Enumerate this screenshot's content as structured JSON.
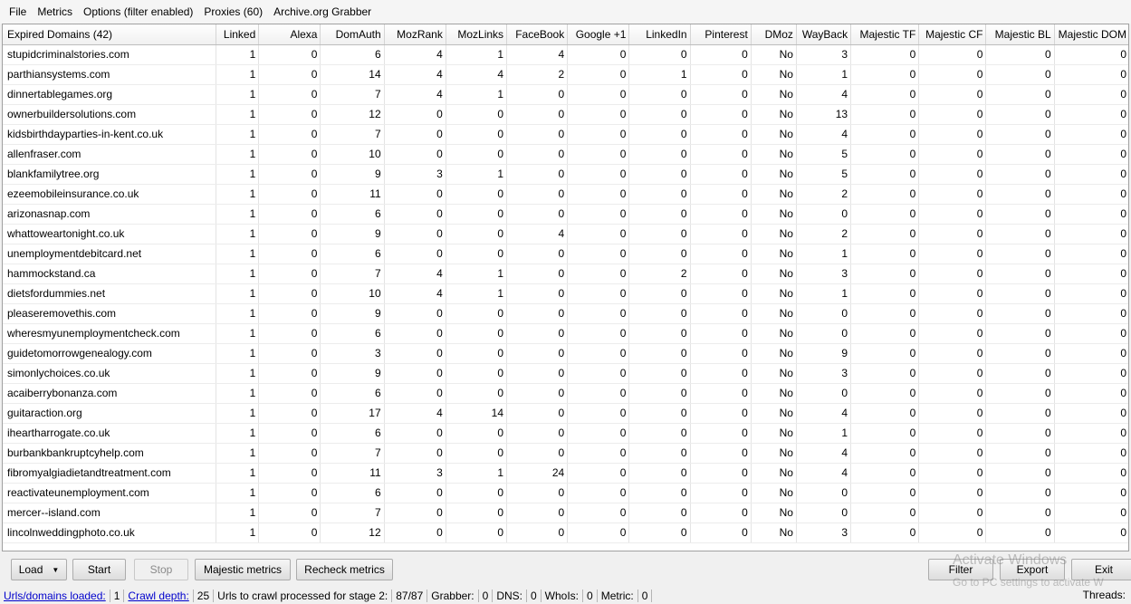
{
  "menu": [
    "File",
    "Metrics",
    "Options (filter enabled)",
    "Proxies (60)",
    "Archive.org Grabber"
  ],
  "table": {
    "columns": [
      "Expired Domains (42)",
      "Linked",
      "Alexa",
      "DomAuth",
      "MozRank",
      "MozLinks",
      "FaceBook",
      "Google +1",
      "LinkedIn",
      "Pinterest",
      "DMoz",
      "WayBack",
      "Majestic TF",
      "Majestic CF",
      "Majestic BL",
      "Majestic DOM"
    ],
    "rows": [
      [
        "stupidcriminalstories.com",
        "1",
        "0",
        "6",
        "4",
        "1",
        "4",
        "0",
        "0",
        "0",
        "No",
        "3",
        "0",
        "0",
        "0",
        "0"
      ],
      [
        "parthiansystems.com",
        "1",
        "0",
        "14",
        "4",
        "4",
        "2",
        "0",
        "1",
        "0",
        "No",
        "1",
        "0",
        "0",
        "0",
        "0"
      ],
      [
        "dinnertablegames.org",
        "1",
        "0",
        "7",
        "4",
        "1",
        "0",
        "0",
        "0",
        "0",
        "No",
        "4",
        "0",
        "0",
        "0",
        "0"
      ],
      [
        "ownerbuildersolutions.com",
        "1",
        "0",
        "12",
        "0",
        "0",
        "0",
        "0",
        "0",
        "0",
        "No",
        "13",
        "0",
        "0",
        "0",
        "0"
      ],
      [
        "kidsbirthdayparties-in-kent.co.uk",
        "1",
        "0",
        "7",
        "0",
        "0",
        "0",
        "0",
        "0",
        "0",
        "No",
        "4",
        "0",
        "0",
        "0",
        "0"
      ],
      [
        "allenfraser.com",
        "1",
        "0",
        "10",
        "0",
        "0",
        "0",
        "0",
        "0",
        "0",
        "No",
        "5",
        "0",
        "0",
        "0",
        "0"
      ],
      [
        "blankfamilytree.org",
        "1",
        "0",
        "9",
        "3",
        "1",
        "0",
        "0",
        "0",
        "0",
        "No",
        "5",
        "0",
        "0",
        "0",
        "0"
      ],
      [
        "ezeemobileinsurance.co.uk",
        "1",
        "0",
        "11",
        "0",
        "0",
        "0",
        "0",
        "0",
        "0",
        "No",
        "2",
        "0",
        "0",
        "0",
        "0"
      ],
      [
        "arizonasnap.com",
        "1",
        "0",
        "6",
        "0",
        "0",
        "0",
        "0",
        "0",
        "0",
        "No",
        "0",
        "0",
        "0",
        "0",
        "0"
      ],
      [
        "whattoweartonight.co.uk",
        "1",
        "0",
        "9",
        "0",
        "0",
        "4",
        "0",
        "0",
        "0",
        "No",
        "2",
        "0",
        "0",
        "0",
        "0"
      ],
      [
        "unemploymentdebitcard.net",
        "1",
        "0",
        "6",
        "0",
        "0",
        "0",
        "0",
        "0",
        "0",
        "No",
        "1",
        "0",
        "0",
        "0",
        "0"
      ],
      [
        "hammockstand.ca",
        "1",
        "0",
        "7",
        "4",
        "1",
        "0",
        "0",
        "2",
        "0",
        "No",
        "3",
        "0",
        "0",
        "0",
        "0"
      ],
      [
        "dietsfordummies.net",
        "1",
        "0",
        "10",
        "4",
        "1",
        "0",
        "0",
        "0",
        "0",
        "No",
        "1",
        "0",
        "0",
        "0",
        "0"
      ],
      [
        "pleaseremovethis.com",
        "1",
        "0",
        "9",
        "0",
        "0",
        "0",
        "0",
        "0",
        "0",
        "No",
        "0",
        "0",
        "0",
        "0",
        "0"
      ],
      [
        "wheresmyunemploymentcheck.com",
        "1",
        "0",
        "6",
        "0",
        "0",
        "0",
        "0",
        "0",
        "0",
        "No",
        "0",
        "0",
        "0",
        "0",
        "0"
      ],
      [
        "guidetomorrowgenealogy.com",
        "1",
        "0",
        "3",
        "0",
        "0",
        "0",
        "0",
        "0",
        "0",
        "No",
        "9",
        "0",
        "0",
        "0",
        "0"
      ],
      [
        "simonlychoices.co.uk",
        "1",
        "0",
        "9",
        "0",
        "0",
        "0",
        "0",
        "0",
        "0",
        "No",
        "3",
        "0",
        "0",
        "0",
        "0"
      ],
      [
        "acaiberrybonanza.com",
        "1",
        "0",
        "6",
        "0",
        "0",
        "0",
        "0",
        "0",
        "0",
        "No",
        "0",
        "0",
        "0",
        "0",
        "0"
      ],
      [
        "guitaraction.org",
        "1",
        "0",
        "17",
        "4",
        "14",
        "0",
        "0",
        "0",
        "0",
        "No",
        "4",
        "0",
        "0",
        "0",
        "0"
      ],
      [
        "iheartharrogate.co.uk",
        "1",
        "0",
        "6",
        "0",
        "0",
        "0",
        "0",
        "0",
        "0",
        "No",
        "1",
        "0",
        "0",
        "0",
        "0"
      ],
      [
        "burbankbankruptcyhelp.com",
        "1",
        "0",
        "7",
        "0",
        "0",
        "0",
        "0",
        "0",
        "0",
        "No",
        "4",
        "0",
        "0",
        "0",
        "0"
      ],
      [
        "fibromyalgiadietandtreatment.com",
        "1",
        "0",
        "11",
        "3",
        "1",
        "24",
        "0",
        "0",
        "0",
        "No",
        "4",
        "0",
        "0",
        "0",
        "0"
      ],
      [
        "reactivateunemployment.com",
        "1",
        "0",
        "6",
        "0",
        "0",
        "0",
        "0",
        "0",
        "0",
        "No",
        "0",
        "0",
        "0",
        "0",
        "0"
      ],
      [
        "mercer--island.com",
        "1",
        "0",
        "7",
        "0",
        "0",
        "0",
        "0",
        "0",
        "0",
        "No",
        "0",
        "0",
        "0",
        "0",
        "0"
      ],
      [
        "lincolnweddingphoto.co.uk",
        "1",
        "0",
        "12",
        "0",
        "0",
        "0",
        "0",
        "0",
        "0",
        "No",
        "3",
        "0",
        "0",
        "0",
        "0"
      ]
    ]
  },
  "toolbar": {
    "load": "Load",
    "start": "Start",
    "stop": "Stop",
    "majestic": "Majestic metrics",
    "recheck": "Recheck metrics",
    "filter": "Filter",
    "export": "Export",
    "exit": "Exit"
  },
  "watermark": {
    "line1": "Activate Windows",
    "line2": "Go to PC settings to activate W"
  },
  "status": {
    "urls_label": "Urls/domains loaded:",
    "urls_value": "1",
    "crawl_label": "Crawl depth:",
    "crawl_value": "25",
    "stage2_label": "Urls to crawl processed for stage 2:",
    "stage2_value": "87/87",
    "grabber_label": "Grabber:",
    "grabber_value": "0",
    "dns_label": "DNS:",
    "dns_value": "0",
    "whois_label": "WhoIs:",
    "whois_value": "0",
    "metric_label": "Metric:",
    "metric_value": "0",
    "threads_label": "Threads:"
  }
}
